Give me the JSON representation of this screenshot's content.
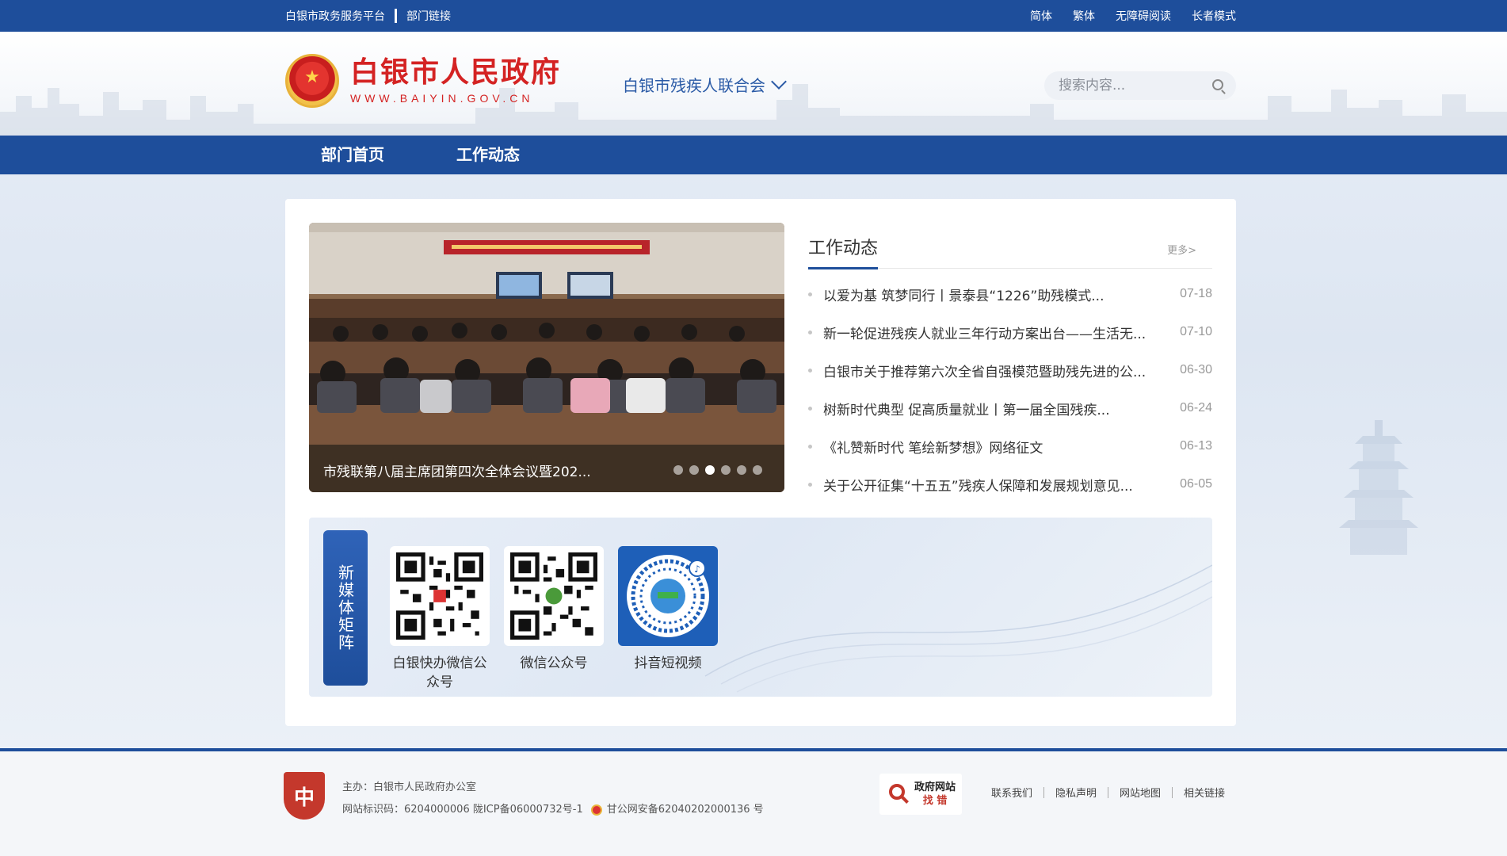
{
  "topbar": {
    "left_links": [
      "白银市政务服务平台",
      "部门链接"
    ],
    "right_links": [
      "简体",
      "繁体",
      "无障碍阅读",
      "长者模式"
    ]
  },
  "header": {
    "site_title": "白银市人民政府",
    "site_url": "WWW.BAIYIN.GOV.CN",
    "department": "白银市残疾人联合会",
    "search_placeholder": "搜索内容..."
  },
  "nav": {
    "items": [
      "部门首页",
      "工作动态"
    ]
  },
  "carousel": {
    "caption": "市残联第八届主席团第四次全体会议暨202...",
    "dot_count": 6,
    "active_dot": 2
  },
  "news": {
    "title": "工作动态",
    "more_label": "更多>",
    "items": [
      {
        "title": "以爱为基 筑梦同行丨景泰县“1226”助残模式...",
        "date": "07-18"
      },
      {
        "title": "新一轮促进残疾人就业三年行动方案出台——生活无...",
        "date": "07-10"
      },
      {
        "title": "白银市关于推荐第六次全省自强模范暨助残先进的公...",
        "date": "06-30"
      },
      {
        "title": "树新时代典型 促高质量就业丨第一届全国残疾...",
        "date": "06-24"
      },
      {
        "title": "《礼赞新时代 笔绘新梦想》网络征文",
        "date": "06-13"
      },
      {
        "title": "关于公开征集“十五五”残疾人保障和发展规划意见...",
        "date": "06-05"
      }
    ]
  },
  "media": {
    "tab_label": "新媒体矩阵",
    "items": [
      {
        "label": "白银快办微信公众号"
      },
      {
        "label": "微信公众号"
      },
      {
        "label": "抖音短视频"
      }
    ]
  },
  "footer": {
    "host": "主办：白银市人民政府办公室",
    "site_code": "网站标识码：6204000006 陇ICP备06000732号-1",
    "police_record": "甘公网安备62040202000136 号",
    "find_error_line1": "政府网站",
    "find_error_line2": "找 错",
    "links": [
      "联系我们",
      "隐私声明",
      "网站地图",
      "相关链接"
    ],
    "badge_char": "中"
  },
  "colors": {
    "primary_blue": "#1e4e9b",
    "brand_red": "#d42323"
  }
}
